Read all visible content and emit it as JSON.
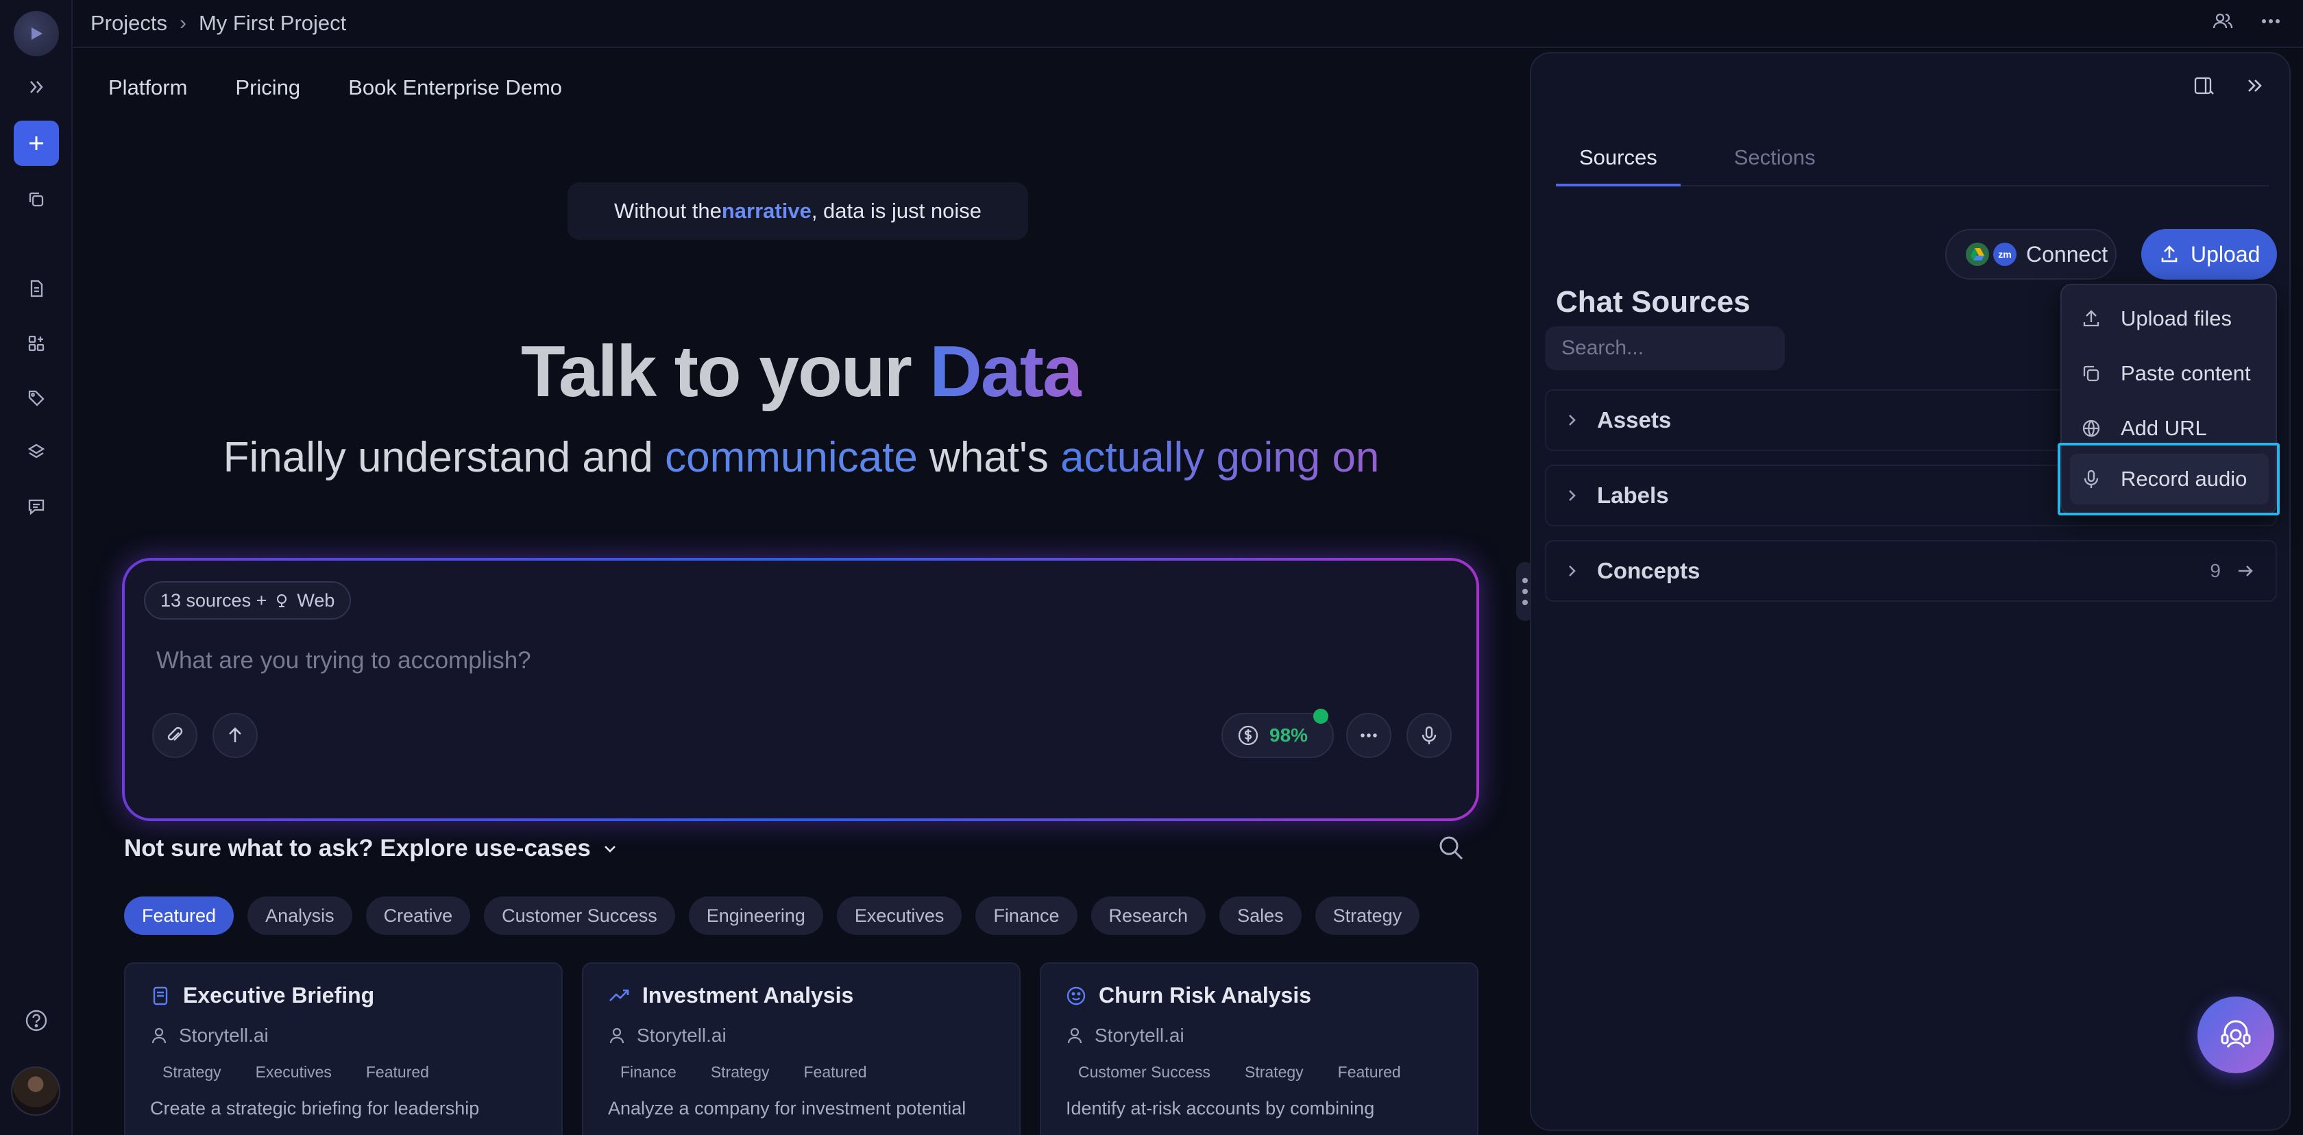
{
  "breadcrumb": {
    "root": "Projects",
    "current": "My First Project"
  },
  "nav": {
    "items": [
      "Platform",
      "Pricing",
      "Book Enterprise Demo"
    ]
  },
  "tagline": {
    "before": "Without the ",
    "highlight": "narrative",
    "after": ", data is just noise"
  },
  "hero": {
    "title_plain": "Talk to your ",
    "title_accent": "Data",
    "sub_1": "Finally understand and ",
    "sub_accent_1": "communicate",
    "sub_2": " what's ",
    "sub_accent_2": "actually going on"
  },
  "prompt": {
    "sources_chip": "13 sources + ",
    "web_label": "Web",
    "placeholder": "What are you trying to accomplish?",
    "credit": "98%"
  },
  "explore": {
    "title": "Not sure what to ask? Explore use-cases",
    "filters": [
      "Featured",
      "Analysis",
      "Creative",
      "Customer Success",
      "Engineering",
      "Executives",
      "Finance",
      "Research",
      "Sales",
      "Strategy"
    ],
    "cards": [
      {
        "title": "Executive Briefing",
        "author": "Storytell.ai",
        "tags": [
          "Strategy",
          "Executives",
          "Featured"
        ],
        "desc": "Create a strategic briefing for leadership",
        "icon": "document-icon"
      },
      {
        "title": "Investment Analysis",
        "author": "Storytell.ai",
        "tags": [
          "Finance",
          "Strategy",
          "Featured"
        ],
        "desc": "Analyze a company for investment potential",
        "icon": "trend-icon"
      },
      {
        "title": "Churn Risk Analysis",
        "author": "Storytell.ai",
        "tags": [
          "Customer Success",
          "Strategy",
          "Featured"
        ],
        "desc": "Identify at-risk accounts by combining",
        "icon": "smile-icon"
      }
    ]
  },
  "panel": {
    "tabs": [
      "Sources",
      "Sections"
    ],
    "title": "Chat Sources",
    "connect_label": "Connect",
    "connect_logo_text": "zm",
    "upload_label": "Upload",
    "search_placeholder": "Search...",
    "accordions": [
      {
        "label": "Assets",
        "count": ""
      },
      {
        "label": "Labels",
        "count": ""
      },
      {
        "label": "Concepts",
        "count": "9"
      }
    ]
  },
  "upload_menu": {
    "items": [
      "Upload files",
      "Paste content",
      "Add URL",
      "Record audio"
    ],
    "selected": "Record audio"
  },
  "colors": {
    "accent": "#3c5ed8",
    "focus_ring": "#2ab4e8",
    "credit_green": "#2fb876"
  }
}
